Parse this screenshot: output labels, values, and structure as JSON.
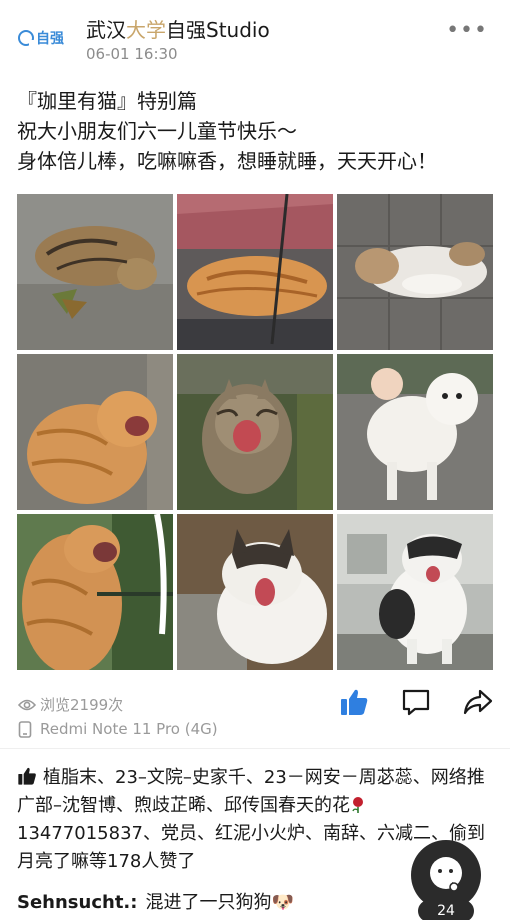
{
  "post": {
    "avatar_logo_text": "自强",
    "username_part1": "武汉",
    "username_part2": "大学",
    "username_part3": "自强Studio",
    "timestamp": "06-01 16:30",
    "text_lines": [
      "『珈里有猫』特别篇",
      "祝大小朋友们六一儿童节快乐～",
      "身体倍儿棒，吃嘛嘛香，想睡就睡，天天开心！"
    ],
    "images": [
      {
        "subject": "tabby cat rolling on pavement"
      },
      {
        "subject": "orange tabby cat sleeping on bicycle seat"
      },
      {
        "subject": "white and tabby cat lying on tiles"
      },
      {
        "subject": "orange tabby cat yawning"
      },
      {
        "subject": "tabby cat hissing in grass"
      },
      {
        "subject": "white fluffy dog in dress"
      },
      {
        "subject": "orange tabby cat yawning by fence"
      },
      {
        "subject": "black and white cat yawning"
      },
      {
        "subject": "black and white cat meowing on path"
      }
    ]
  },
  "meta": {
    "views": "浏览2199次",
    "device": "Redmi Note 11 Pro (4G)"
  },
  "icons": {
    "views": "eye-icon",
    "device": "phone-icon",
    "like": "thumbs-up-icon",
    "comment": "comment-icon",
    "share": "share-icon",
    "more": "more-icon"
  },
  "likes": {
    "text_before_rose": "植脂末、23–文院–史家千、23－网安－周苾蕊、网络推广部–沈智博、煦歧芷晞、邱传国春天的花",
    "text_after_rose": "13477015837、党员、红泥小火炉、南辞、六减二、偷到月亮了嘛等178人赞了"
  },
  "comment": {
    "author": "Sehnsucht.:",
    "text": "混进了一只狗狗🐶"
  },
  "floating": {
    "badge": "24"
  },
  "colors": {
    "accent_blue": "#3a8bd8",
    "gold": "#c9a66b",
    "meta_gray": "#9a9a9a"
  }
}
